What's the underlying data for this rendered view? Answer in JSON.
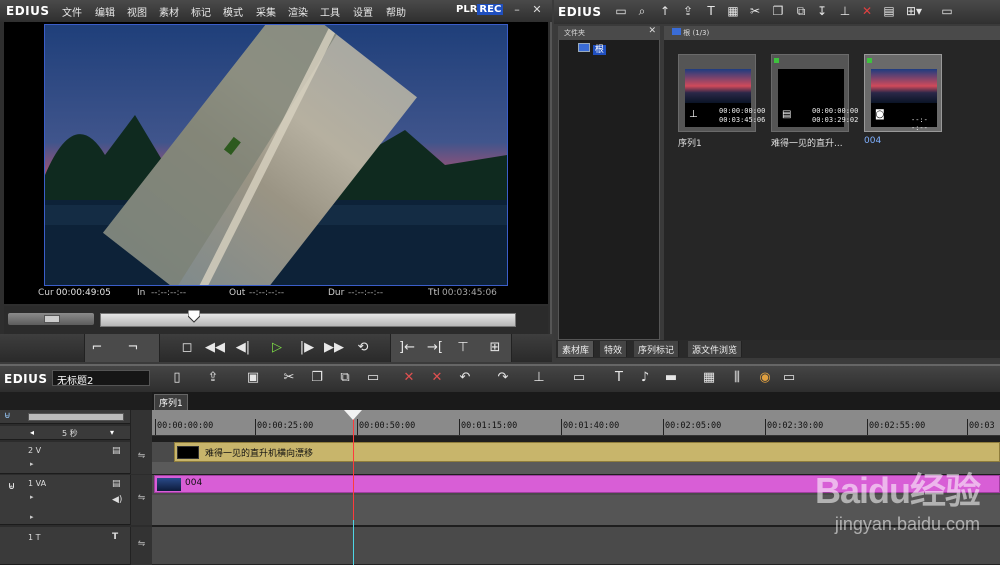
{
  "player": {
    "logo": "EDIUS",
    "menu": [
      "文件",
      "编辑",
      "视图",
      "素材",
      "标记",
      "模式",
      "采集",
      "渲染",
      "工具",
      "设置",
      "帮助"
    ],
    "plr": "PLR",
    "rec": "REC",
    "timecodes": {
      "cur_label": "Cur",
      "cur_value": "00:00:49:05",
      "in_label": "In",
      "in_value": "--:--:--:--",
      "out_label": "Out",
      "out_value": "--:--:--:--",
      "dur_label": "Dur",
      "dur_value": "--:--:--:--",
      "ttl_label": "Ttl",
      "ttl_value": "00:03:45:06"
    }
  },
  "bin": {
    "logo": "EDIUS",
    "folder_header": "文件夹",
    "root_label": "根",
    "clip_header": "根 (1/3)",
    "clips": [
      {
        "name": "序列1",
        "tc_top": "00:00:00:00",
        "tc_bottom": "00:03:45:06",
        "type_icon": "sequence-icon"
      },
      {
        "name": "难得一见的直升...",
        "tc_top": "00:00:00:00",
        "tc_bottom": "00:03:29:02",
        "type_icon": "film-icon"
      },
      {
        "name": "004",
        "tc_top": "",
        "tc_bottom": "--:--:--",
        "type_icon": "camera-icon"
      }
    ],
    "tabs": [
      "素材库",
      "特效",
      "序列标记",
      "源文件浏览"
    ]
  },
  "timeline": {
    "logo": "EDIUS",
    "project_name": "无标题2",
    "sequence_tab": "序列1",
    "zoom_label": "5 秒",
    "ruler_ticks": [
      "00:00:00:00",
      "00:00:25:00",
      "00:00:50:00",
      "00:01:15:00",
      "00:01:40:00",
      "00:02:05:00",
      "00:02:30:00",
      "00:02:55:00",
      "00:03"
    ],
    "tracks": [
      {
        "label": "2 V",
        "clip": "难得一见的直升机横向漂移"
      },
      {
        "label": "1 VA",
        "clip": "004"
      },
      {
        "label": "1 T",
        "clip": ""
      }
    ]
  },
  "watermark": {
    "logo": "Baidu经验",
    "url": "jingyan.baidu.com"
  },
  "colors": {
    "accent": "#1f4fbf",
    "v_clip": "#c8b56b",
    "va_clip": "#d85ed6",
    "playhead": "#ff3b3b",
    "play_button": "#7ddb46"
  }
}
